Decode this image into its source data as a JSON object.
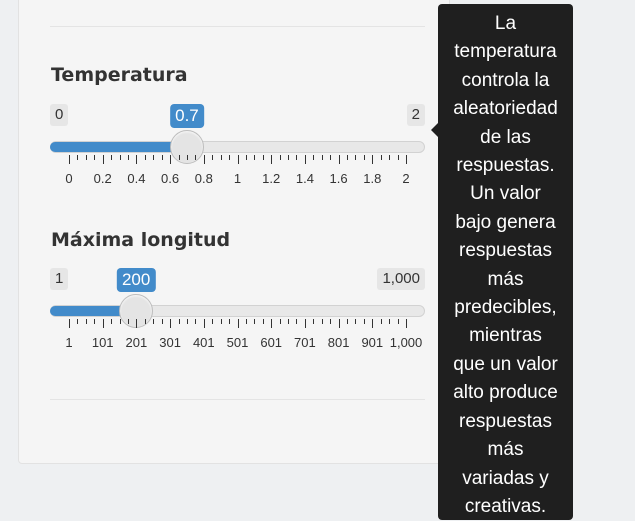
{
  "sliders": [
    {
      "label": "Temperatura",
      "min_label": "0",
      "max_label": "2",
      "value_label": "0.7",
      "value": 0.7,
      "min": 0,
      "max": 2,
      "tick_labels": [
        "0",
        "0.2",
        "0.4",
        "0.6",
        "0.8",
        "1",
        "1.2",
        "1.4",
        "1.6",
        "1.8",
        "2"
      ]
    },
    {
      "label": "Máxima longitud",
      "min_label": "1",
      "max_label": "1,000",
      "value_label": "200",
      "value": 200,
      "min": 1,
      "max": 1000,
      "tick_labels": [
        "1",
        "101",
        "201",
        "301",
        "401",
        "501",
        "601",
        "701",
        "801",
        "901",
        "1,000"
      ]
    }
  ],
  "tooltip": {
    "lines": [
      "La",
      "temperatura",
      "controla la",
      "aleatoriedad",
      "de las",
      "respuestas.",
      "Un valor",
      "bajo genera",
      "respuestas",
      "más",
      "predecibles,",
      "mientras",
      "que un valor",
      "alto produce",
      "respuestas",
      "más",
      "variadas y",
      "creativas."
    ]
  },
  "colors": {
    "accent": "#428bca",
    "tooltip_bg": "#1f1f1f",
    "panel_bg": "#f5f5f5"
  }
}
